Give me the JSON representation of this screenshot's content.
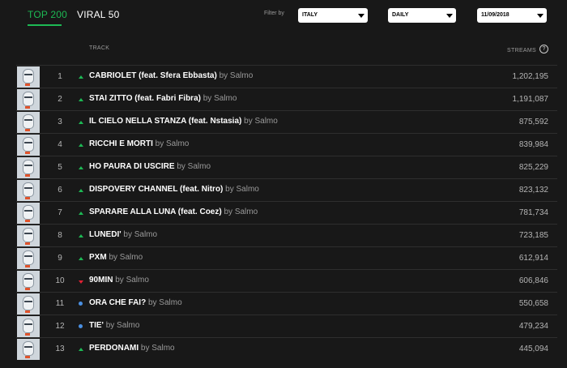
{
  "tabs": {
    "top200": "TOP 200",
    "viral50": "VIRAL 50"
  },
  "filters": {
    "label": "Filter by",
    "country": "ITALY",
    "frequency": "DAILY",
    "date": "11/09/2018"
  },
  "headers": {
    "track": "TRACK",
    "streams": "STREAMS",
    "help": "?"
  },
  "colors": {
    "accent": "#1db954",
    "up": "#1db954",
    "down": "#e22134",
    "new": "#4a90e2"
  },
  "rows": [
    {
      "rank": "1",
      "trend": "up",
      "title": "CABRIOLET (feat. Sfera Ebbasta)",
      "artist": "by Salmo",
      "streams": "1,202,195"
    },
    {
      "rank": "2",
      "trend": "up",
      "title": "STAI ZITTO (feat. Fabri Fibra)",
      "artist": "by Salmo",
      "streams": "1,191,087"
    },
    {
      "rank": "3",
      "trend": "up",
      "title": "IL CIELO NELLA STANZA (feat. Nstasia)",
      "artist": "by Salmo",
      "streams": "875,592"
    },
    {
      "rank": "4",
      "trend": "up",
      "title": "RICCHI E MORTI",
      "artist": "by Salmo",
      "streams": "839,984"
    },
    {
      "rank": "5",
      "trend": "up",
      "title": "HO PAURA DI USCIRE",
      "artist": "by Salmo",
      "streams": "825,229"
    },
    {
      "rank": "6",
      "trend": "up",
      "title": "DISPOVERY CHANNEL (feat. Nitro)",
      "artist": "by Salmo",
      "streams": "823,132"
    },
    {
      "rank": "7",
      "trend": "up",
      "title": "SPARARE ALLA LUNA (feat. Coez)",
      "artist": "by Salmo",
      "streams": "781,734"
    },
    {
      "rank": "8",
      "trend": "up",
      "title": "LUNEDI'",
      "artist": "by Salmo",
      "streams": "723,185"
    },
    {
      "rank": "9",
      "trend": "up",
      "title": "PXM",
      "artist": "by Salmo",
      "streams": "612,914"
    },
    {
      "rank": "10",
      "trend": "down",
      "title": "90MIN",
      "artist": "by Salmo",
      "streams": "606,846"
    },
    {
      "rank": "11",
      "trend": "new",
      "title": "ORA CHE FAI?",
      "artist": "by Salmo",
      "streams": "550,658"
    },
    {
      "rank": "12",
      "trend": "new",
      "title": "TIE'",
      "artist": "by Salmo",
      "streams": "479,234"
    },
    {
      "rank": "13",
      "trend": "up",
      "title": "PERDONAMI",
      "artist": "by Salmo",
      "streams": "445,094"
    }
  ]
}
